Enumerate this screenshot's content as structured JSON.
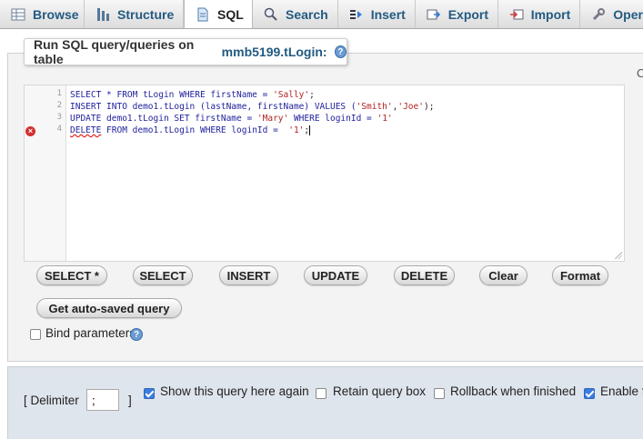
{
  "tabs": [
    {
      "label": "Browse",
      "icon": "browse-table-icon",
      "active": false
    },
    {
      "label": "Structure",
      "icon": "structure-icon",
      "active": false
    },
    {
      "label": "SQL",
      "icon": "sql-icon",
      "active": true
    },
    {
      "label": "Search",
      "icon": "search-icon",
      "active": false
    },
    {
      "label": "Insert",
      "icon": "insert-icon",
      "active": false
    },
    {
      "label": "Export",
      "icon": "export-icon",
      "active": false
    },
    {
      "label": "Import",
      "icon": "import-icon",
      "active": false
    },
    {
      "label": "Operat",
      "icon": "wrench-icon",
      "active": false
    }
  ],
  "legend": {
    "prefix": "Run SQL query/queries on table",
    "table": "mmb5199.tLogin:",
    "help": "?"
  },
  "cut_letter": "C",
  "editor": {
    "line_numbers": [
      "1",
      "2",
      "3",
      "4"
    ],
    "lines": {
      "l1a": "SELECT * FROM tLogin WHERE firstName = ",
      "l1s": "'Sally'",
      "l1e": ";",
      "l2a": "INSERT INTO demo1.tLogin (lastName, firstName) VALUES (",
      "l2s": "'Smith'",
      "l2c": ",",
      "l2s2": "'Joe'",
      "l2e": ");",
      "l3a": "UPDATE demo1.tLogin SET firstName = ",
      "l3s": "'Mary'",
      "l3b": " WHERE loginId = ",
      "l3s2": "'1'",
      "l4kw": "DELETE",
      "l4a": " FROM demo1.tLogin WHERE loginId =  ",
      "l4s": "'1'",
      "l4e": ";"
    },
    "error_line": "4",
    "error_icon": "error-icon"
  },
  "buttons": {
    "select_star": "SELECT *",
    "select": "SELECT",
    "insert": "INSERT",
    "update": "UPDATE",
    "delete": "DELETE",
    "clear": "Clear",
    "format": "Format",
    "autosaved": "Get auto-saved query"
  },
  "bind_parameters": {
    "label": "Bind parameters",
    "checked": false,
    "help": "?"
  },
  "bottom": {
    "delimiter_open": "[ Delimiter",
    "delimiter_value": ";",
    "delimiter_close": "]",
    "options": [
      {
        "label": "Show this query here again",
        "checked": true
      },
      {
        "label": "Retain query box",
        "checked": false
      },
      {
        "label": "Rollback when finished",
        "checked": false
      },
      {
        "label": "Enable f",
        "checked": true
      }
    ]
  },
  "colors": {
    "link": "#235a81",
    "checkbox": "#3b7de0",
    "error": "#d32f2f"
  }
}
